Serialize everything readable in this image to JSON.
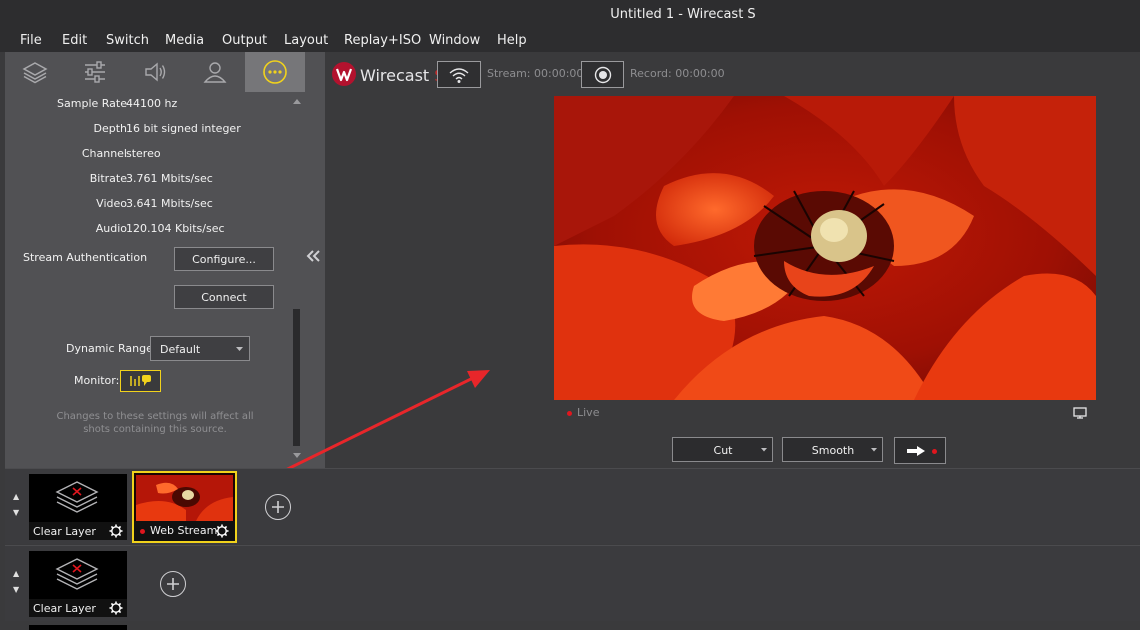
{
  "window": {
    "title": "Untitled 1 - Wirecast S"
  },
  "menu": [
    "File",
    "Edit",
    "Switch",
    "Media",
    "Output",
    "Layout",
    "Replay+ISO",
    "Window",
    "Help"
  ],
  "tabs": [
    "layers-icon",
    "sliders-icon",
    "speaker-icon",
    "user-icon",
    "more-icon"
  ],
  "props": [
    {
      "label": "Sample Rate",
      "value": "44100 hz"
    },
    {
      "label": "Depth",
      "value": "16 bit signed integer"
    },
    {
      "label": "Channel",
      "value": "stereo"
    },
    {
      "label": "Bitrate",
      "value": "3.761 Mbits/sec"
    },
    {
      "label": "Video",
      "value": "3.641 Mbits/sec"
    },
    {
      "label": "Audio",
      "value": "120.104 Kbits/sec"
    }
  ],
  "auth": {
    "label": "Stream Authentication",
    "configure": "Configure...",
    "connect": "Connect"
  },
  "dynamic_range": {
    "label": "Dynamic Range:",
    "value": "Default"
  },
  "monitor_label": "Monitor:",
  "hint": "Changes to these settings will affect all shots containing this source.",
  "brand": {
    "name": "Wirecast",
    "suffix": "S"
  },
  "stream": "Stream: 00:00:00",
  "record": "Record: 00:00:00",
  "live": "Live",
  "transitions": {
    "cut": "Cut",
    "smooth": "Smooth"
  },
  "layers": [
    {
      "shots": [
        {
          "label": "Clear Layer"
        },
        {
          "label": "Web Stream",
          "selected": true
        }
      ]
    },
    {
      "shots": [
        {
          "label": "Clear Layer"
        }
      ]
    }
  ],
  "colors": {
    "accent": "#f1d21c",
    "live_red": "#e0161e"
  }
}
